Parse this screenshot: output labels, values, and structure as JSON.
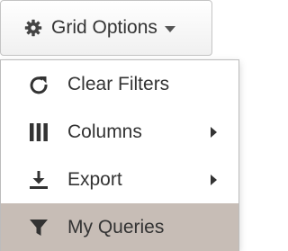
{
  "toolbar": {
    "grid_options_label": "Grid Options",
    "icon": "gear-icon"
  },
  "menu": {
    "items": [
      {
        "label": "Clear Filters",
        "icon": "refresh-icon",
        "has_submenu": false
      },
      {
        "label": "Columns",
        "icon": "columns-icon",
        "has_submenu": true
      },
      {
        "label": "Export",
        "icon": "download-icon",
        "has_submenu": true
      },
      {
        "label": "My Queries",
        "icon": "filter-icon",
        "has_submenu": false,
        "highlighted": true
      }
    ]
  },
  "colors": {
    "highlight": "#c7bdb6",
    "text": "#333333"
  }
}
